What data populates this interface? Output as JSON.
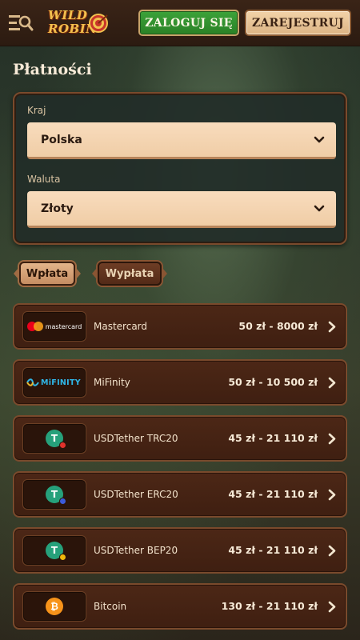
{
  "header": {
    "logo_line1": "WILD",
    "logo_line2": "ROBIN",
    "login_label": "ZALOGUJ SIĘ",
    "register_label": "ZAREJESTRUJ"
  },
  "page_title": "Płatności",
  "filters": {
    "country_label": "Kraj",
    "country_value": "Polska",
    "currency_label": "Waluta",
    "currency_value": "Złoty"
  },
  "tabs": [
    {
      "label": "Wpłata",
      "active": true
    },
    {
      "label": "Wypłata",
      "active": false
    }
  ],
  "payments": [
    {
      "name": "Mastercard",
      "logo_text": "mastercard",
      "range": "50 zł - 8000 zł"
    },
    {
      "name": "MiFinity",
      "logo_text": "MiFINITY",
      "range": "50 zł - 10 500 zł"
    },
    {
      "name": "USDTether TRC20",
      "logo_text": "T",
      "range": "45 zł - 21 110 zł"
    },
    {
      "name": "USDTether ERC20",
      "logo_text": "T",
      "range": "45 zł - 21 110 zł"
    },
    {
      "name": "USDTether BEP20",
      "logo_text": "T",
      "range": "45 zł - 21 110 zł"
    },
    {
      "name": "Bitcoin",
      "logo_text": "₿",
      "range": "130 zł - 21 110 zł"
    }
  ],
  "colors": {
    "login_green": "#2f8f2c",
    "register_beige": "#e8c49a",
    "card_brown": "#4a2515",
    "tether_green": "#26a17b",
    "bitcoin_orange": "#f7931a"
  }
}
